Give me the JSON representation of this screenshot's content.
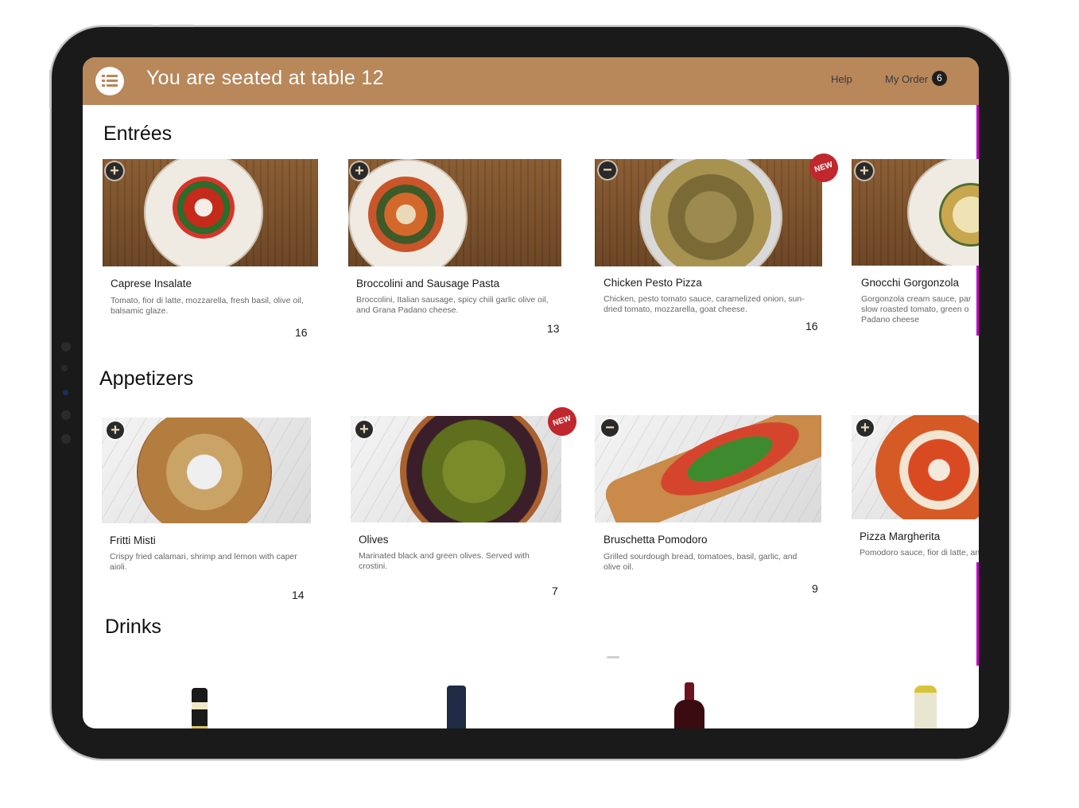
{
  "header": {
    "title": "You are seated at table 12",
    "help_label": "Help",
    "order_label": "My Order",
    "order_count": "6",
    "menu_icon": "list-icon"
  },
  "sections": {
    "entrees": {
      "title": "Entrées",
      "items": [
        {
          "name": "Caprese Insalate",
          "desc": "Tomato, fior di latte, mozzarella, fresh basil, olive oil, balsamic glaze.",
          "price": "16",
          "action": "add"
        },
        {
          "name": "Broccolini and Sausage Pasta",
          "desc": "Broccolini, Italian sausage, spicy chili garlic olive oil, and Grana Padano cheese.",
          "price": "13",
          "action": "add"
        },
        {
          "name": "Chicken Pesto Pizza",
          "desc": "Chicken, pesto tomato sauce, caramelized onion, sun-dried tomato, mozzarella, goat cheese.",
          "price": "16",
          "action": "remove",
          "badge": "NEW"
        },
        {
          "name": "Gnocchi Gorgonzola",
          "desc": "Gorgonzola cream sauce, par slow roasted tomato, green o Padano cheese",
          "action": "add"
        }
      ]
    },
    "appetizers": {
      "title": "Appetizers",
      "items": [
        {
          "name": "Fritti Misti",
          "desc": "Crispy fried calamari, shrimp and lemon with caper aioli.",
          "price": "14",
          "action": "add"
        },
        {
          "name": "Olives",
          "desc": "Marinated black and green olives. Served with crostini.",
          "price": "7",
          "action": "add",
          "badge": "NEW"
        },
        {
          "name": "Bruschetta Pomodoro",
          "desc": "Grilled sourdough bread, tomatoes, basil, garlic, and olive oil.",
          "price": "9",
          "action": "remove"
        },
        {
          "name": "Pizza Margherita",
          "desc": "Pomodoro sauce, fior di latte, and",
          "action": "add"
        }
      ]
    },
    "drinks": {
      "title": "Drinks"
    }
  },
  "colors": {
    "header_bg": "#b8875a",
    "badge_red": "#c0282d",
    "accent_magenta": "#c400c4"
  },
  "icons": {
    "add": "+",
    "remove": "−"
  }
}
